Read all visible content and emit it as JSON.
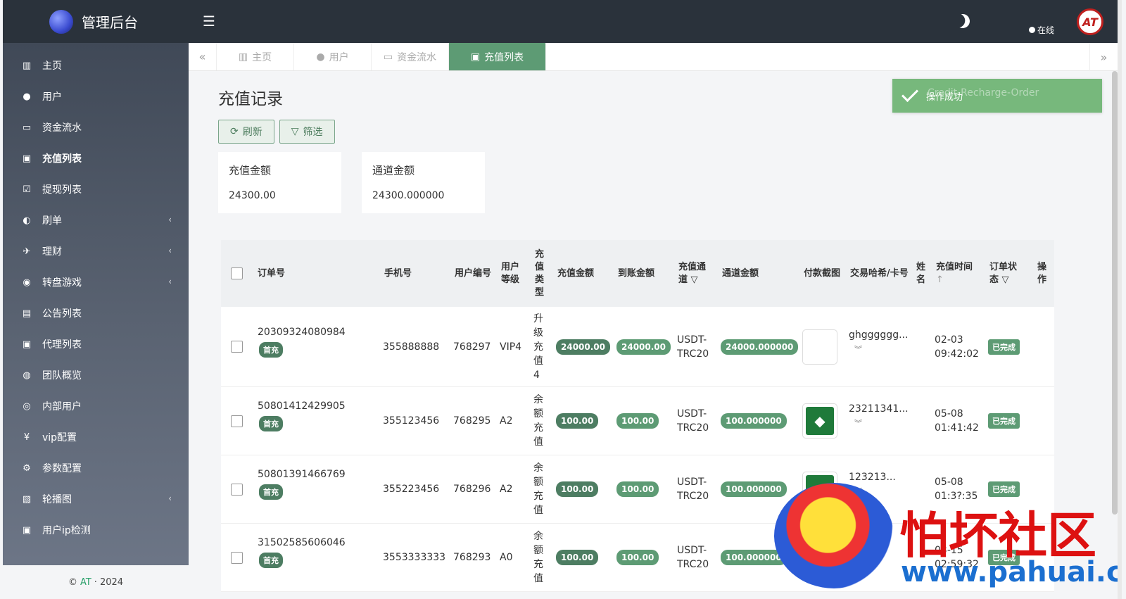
{
  "brand": {
    "name": "管理后台"
  },
  "sidebar": {
    "items": [
      {
        "label": "主页",
        "icon": "bar-chart-icon",
        "glyph": "▥"
      },
      {
        "label": "用户",
        "icon": "user-icon",
        "glyph": "●"
      },
      {
        "label": "资金流水",
        "icon": "money-icon",
        "glyph": "▭"
      },
      {
        "label": "充值列表",
        "icon": "recharge-icon",
        "glyph": "▣"
      },
      {
        "label": "提现列表",
        "icon": "checkbox-icon",
        "glyph": "☑"
      },
      {
        "label": "刷单",
        "icon": "half-circle-icon",
        "glyph": "◐"
      },
      {
        "label": "理财",
        "icon": "money-hand-icon",
        "glyph": "✈"
      },
      {
        "label": "转盘游戏",
        "icon": "gamepad-icon",
        "glyph": "◉"
      },
      {
        "label": "公告列表",
        "icon": "document-icon",
        "glyph": "▤"
      },
      {
        "label": "代理列表",
        "icon": "contact-icon",
        "glyph": "▣"
      },
      {
        "label": "团队概览",
        "icon": "users-icon",
        "glyph": "◍"
      },
      {
        "label": "内部用户",
        "icon": "user-circle-icon",
        "glyph": "◎"
      },
      {
        "label": "vip配置",
        "icon": "yen-icon",
        "glyph": "¥"
      },
      {
        "label": "参数配置",
        "icon": "cogs-icon",
        "glyph": "⚙"
      },
      {
        "label": "轮播图",
        "icon": "image-icon",
        "glyph": "▧"
      },
      {
        "label": "用户ip检测",
        "icon": "id-badge-icon",
        "glyph": "▣"
      }
    ],
    "footer": {
      "copy": "©",
      "brand": "AT",
      "sep": "·",
      "year": "2024"
    }
  },
  "topbar": {
    "status": "在线",
    "avatar": "AT"
  },
  "tabs": [
    {
      "label": "主页",
      "glyph": "▥"
    },
    {
      "label": "用户",
      "glyph": "●"
    },
    {
      "label": "资金流水",
      "glyph": "▭"
    },
    {
      "label": "充值列表",
      "glyph": "▣"
    }
  ],
  "page": {
    "title": "充值记录",
    "refresh": "刷新",
    "filter": "筛选",
    "stats": [
      {
        "label": "充值金额",
        "value": "24300.00"
      },
      {
        "label": "通道金额",
        "value": "24300.000000"
      }
    ],
    "toast": {
      "message": "操作成功",
      "ghost": "Credit-Recharge-Order"
    }
  },
  "table": {
    "headers": {
      "order": "订单号",
      "phone": "手机号",
      "uid": "用户编号",
      "level_1": "用户",
      "level_2": "等级",
      "type_chars": [
        "充",
        "值",
        "类",
        "型"
      ],
      "amount": "充值金额",
      "received": "到账金额",
      "channel_1": "充值通",
      "channel_2": "道",
      "channel_amount": "通道金额",
      "screenshot": "付款截图",
      "hash": "交易哈希/卡号",
      "name_1": "姓",
      "name_2": "名",
      "time": "充值时间",
      "status_1": "订单状",
      "status_2": "态",
      "op_1": "操",
      "op_2": "作"
    },
    "rows": [
      {
        "order": "20309324080984",
        "first": "首充",
        "phone": "355888888",
        "uid": "768297",
        "level": "VIP4",
        "type_chars": [
          "升",
          "级",
          "充",
          "值",
          "4"
        ],
        "amount": "24000.00",
        "received": "24000.00",
        "channel_1": "USDT-",
        "channel_2": "TRC20",
        "channel_amount": "24000.000000",
        "hash": "ghgggggg...",
        "date": "02-03",
        "time": "09:42:02",
        "status": "已完成",
        "thumb": "blank"
      },
      {
        "order": "50801412429905",
        "first": "首充",
        "phone": "355123456",
        "uid": "768295",
        "level": "A2",
        "type_chars": [
          "余",
          "额",
          "充",
          "值"
        ],
        "amount": "100.00",
        "received": "100.00",
        "channel_1": "USDT-",
        "channel_2": "TRC20",
        "channel_amount": "100.000000",
        "hash": "23211341...",
        "date": "05-08",
        "time": "01:41:42",
        "status": "已完成",
        "thumb": "eth"
      },
      {
        "order": "50801391466769",
        "first": "首充",
        "phone": "355223456",
        "uid": "768296",
        "level": "A2",
        "type_chars": [
          "余",
          "额",
          "充",
          "值"
        ],
        "amount": "100.00",
        "received": "100.00",
        "channel_1": "USDT-",
        "channel_2": "TRC20",
        "channel_amount": "100.000000",
        "hash": "123213...",
        "date": "05-08",
        "time": "01:3?:35",
        "status": "已完成",
        "thumb": "eth"
      },
      {
        "order": "31502585606046",
        "first": "首充",
        "phone": "3553333333",
        "uid": "768293",
        "level": "A0",
        "type_chars": [
          "余",
          "额",
          "充",
          "值"
        ],
        "amount": "100.00",
        "received": "100.00",
        "channel_1": "USDT-",
        "channel_2": "TRC20",
        "channel_amount": "100.000000",
        "hash": "3333...",
        "date": "03-15",
        "time": "02:59:32",
        "status": "已完成",
        "thumb": "flowers"
      }
    ]
  },
  "watermark": {
    "text": "怕坏社区",
    "url": "www.pahuai.com"
  },
  "colors": {
    "accent": "#5d9b74",
    "topbar": "#2a323b",
    "toast": "#77b87c"
  }
}
